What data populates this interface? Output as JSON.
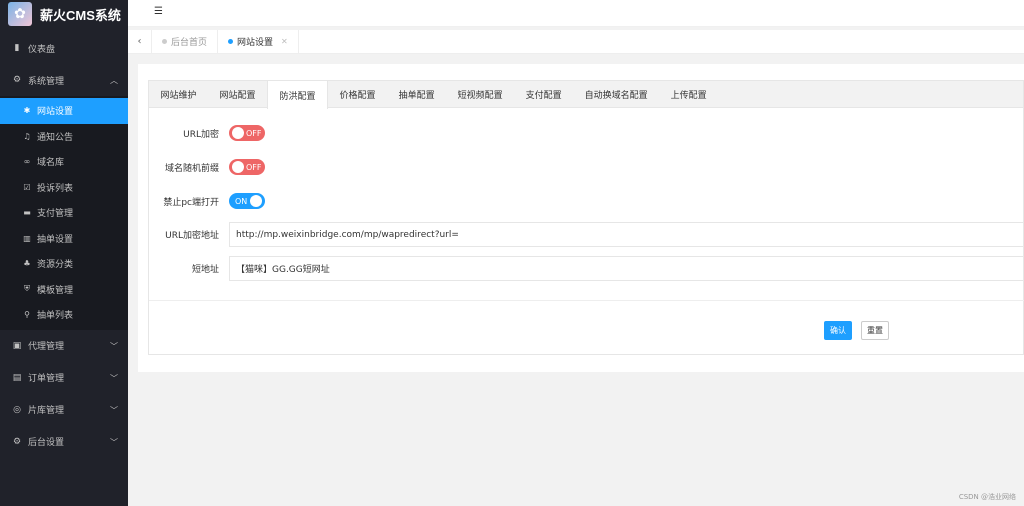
{
  "app": {
    "title": "薪火CMS系统"
  },
  "sidebar": {
    "items": [
      {
        "label": "仪表盘"
      },
      {
        "label": "系统管理"
      },
      {
        "label": "代理管理"
      },
      {
        "label": "订单管理"
      },
      {
        "label": "片库管理"
      },
      {
        "label": "后台设置"
      }
    ],
    "sub_items": [
      {
        "label": "网站设置"
      },
      {
        "label": "通知公告"
      },
      {
        "label": "域名库"
      },
      {
        "label": "投诉列表"
      },
      {
        "label": "支付管理"
      },
      {
        "label": "抽单设置"
      },
      {
        "label": "资源分类"
      },
      {
        "label": "模板管理"
      },
      {
        "label": "抽单列表"
      }
    ]
  },
  "page_tabs": [
    {
      "label": "后台首页"
    },
    {
      "label": "网站设置"
    }
  ],
  "config_tabs": [
    {
      "label": "网站维护"
    },
    {
      "label": "网站配置"
    },
    {
      "label": "防洪配置"
    },
    {
      "label": "价格配置"
    },
    {
      "label": "抽单配置"
    },
    {
      "label": "短视频配置"
    },
    {
      "label": "支付配置"
    },
    {
      "label": "自动换域名配置"
    },
    {
      "label": "上传配置"
    }
  ],
  "form": {
    "url_encrypt": {
      "label": "URL加密",
      "state": "OFF"
    },
    "domain_random_prefix": {
      "label": "域名随机前缀",
      "state": "OFF"
    },
    "block_pc": {
      "label": "禁止pc端打开",
      "state": "ON"
    },
    "url_encrypt_address": {
      "label": "URL加密地址",
      "value": "http://mp.weixinbridge.com/mp/wapredirect?url="
    },
    "short_url": {
      "label": "短地址",
      "value": "【猫咪】GG.GG短网址"
    }
  },
  "buttons": {
    "confirm": "确认",
    "reset": "重置"
  },
  "watermark": "CSDN @浩业网络",
  "colors": {
    "sidebar_bg": "#20222a",
    "accent": "#1e9fff",
    "switch_off": "#ee6666"
  }
}
